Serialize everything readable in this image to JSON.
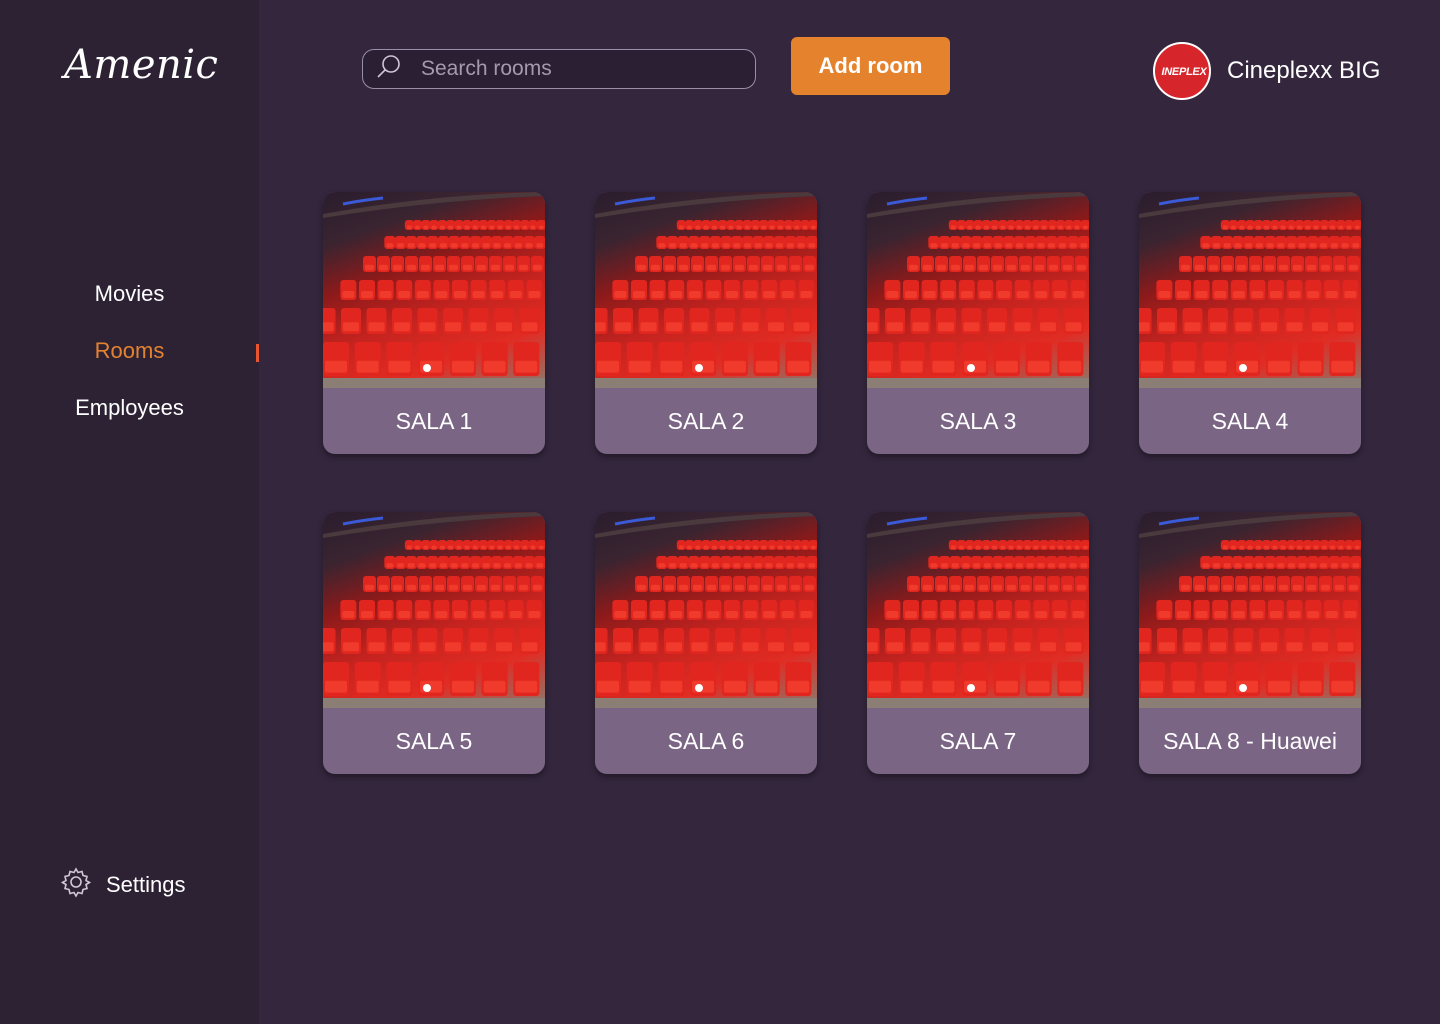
{
  "sidebar": {
    "logo": "Amenic",
    "nav": [
      {
        "label": "Movies",
        "active": false
      },
      {
        "label": "Rooms",
        "active": true
      },
      {
        "label": "Employees",
        "active": false
      }
    ],
    "settings_label": "Settings"
  },
  "header": {
    "search_placeholder": "Search rooms",
    "add_button_label": "Add room",
    "profile_name": "Cineplexx BIG",
    "brand_logo_text": "INEPLEX"
  },
  "rooms": [
    {
      "name": "SALA 1"
    },
    {
      "name": "SALA 2"
    },
    {
      "name": "SALA 3"
    },
    {
      "name": "SALA 4"
    },
    {
      "name": "SALA 5"
    },
    {
      "name": "SALA 6"
    },
    {
      "name": "SALA 7"
    },
    {
      "name": "SALA 8 - Huawei"
    }
  ],
  "colors": {
    "background": "#33263d",
    "sidebar": "#2c2234",
    "accent": "#e5822d",
    "card_footer": "#7a6585",
    "active_indicator": "#e8552f"
  }
}
